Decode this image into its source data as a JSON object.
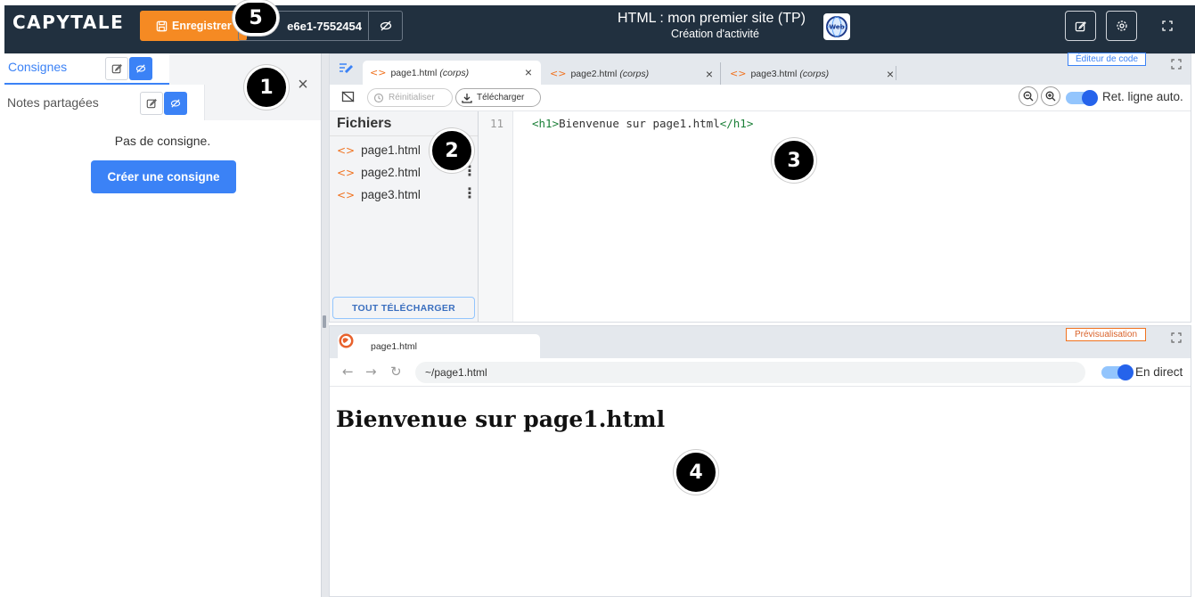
{
  "header": {
    "logo": "CAPYTALE",
    "save_label": "Enregistrer",
    "activity_code": "e6e1-7552454",
    "title": "HTML : mon premier site (TP)",
    "subtitle": "Création d'activité",
    "badge_text": "Web",
    "icons": [
      "save-icon",
      "eye-slash-icon",
      "edit-icon",
      "gear-icon",
      "fullscreen-icon"
    ]
  },
  "left_panel": {
    "tabs": [
      {
        "label": "Consignes",
        "active": true
      },
      {
        "label": "Notes partagées",
        "active": false
      }
    ],
    "close_symbol": "×",
    "empty_text": "Pas de consigne.",
    "create_button": "Créer une consigne"
  },
  "editor": {
    "role_label": "Éditeur de code",
    "tabs": [
      {
        "name": "page1.html",
        "tag": "(corps)",
        "active": true
      },
      {
        "name": "page2.html",
        "tag": "(corps)",
        "active": false
      },
      {
        "name": "page3.html",
        "tag": "(corps)",
        "active": false
      }
    ],
    "tab_close": "×",
    "toolbar": {
      "reset": "Réinitialiser",
      "download": "Télécharger",
      "wrap_label": "Ret. ligne auto.",
      "wrap_enabled": true
    },
    "files": {
      "title": "Fichiers",
      "items": [
        "page1.html",
        "page2.html",
        "page3.html"
      ],
      "download_all": "TOUT TÉLÉCHARGER"
    },
    "code": {
      "line_number": "11",
      "open_tag": "<h1>",
      "text": "Bienvenue sur page1.html",
      "close_tag": "</h1>"
    }
  },
  "preview": {
    "role_label": "Prévisualisation",
    "tab_name": "page1.html",
    "url": "~/page1.html",
    "live_label": "En direct",
    "live_enabled": true,
    "h1": "Bienvenue sur page1.html"
  },
  "markers": [
    "1",
    "2",
    "3",
    "4",
    "5"
  ],
  "colors": {
    "header_bg": "#21303f",
    "accent_orange": "#f58a23",
    "accent_blue": "#3b82f6",
    "html_icon": "#f0721f"
  }
}
